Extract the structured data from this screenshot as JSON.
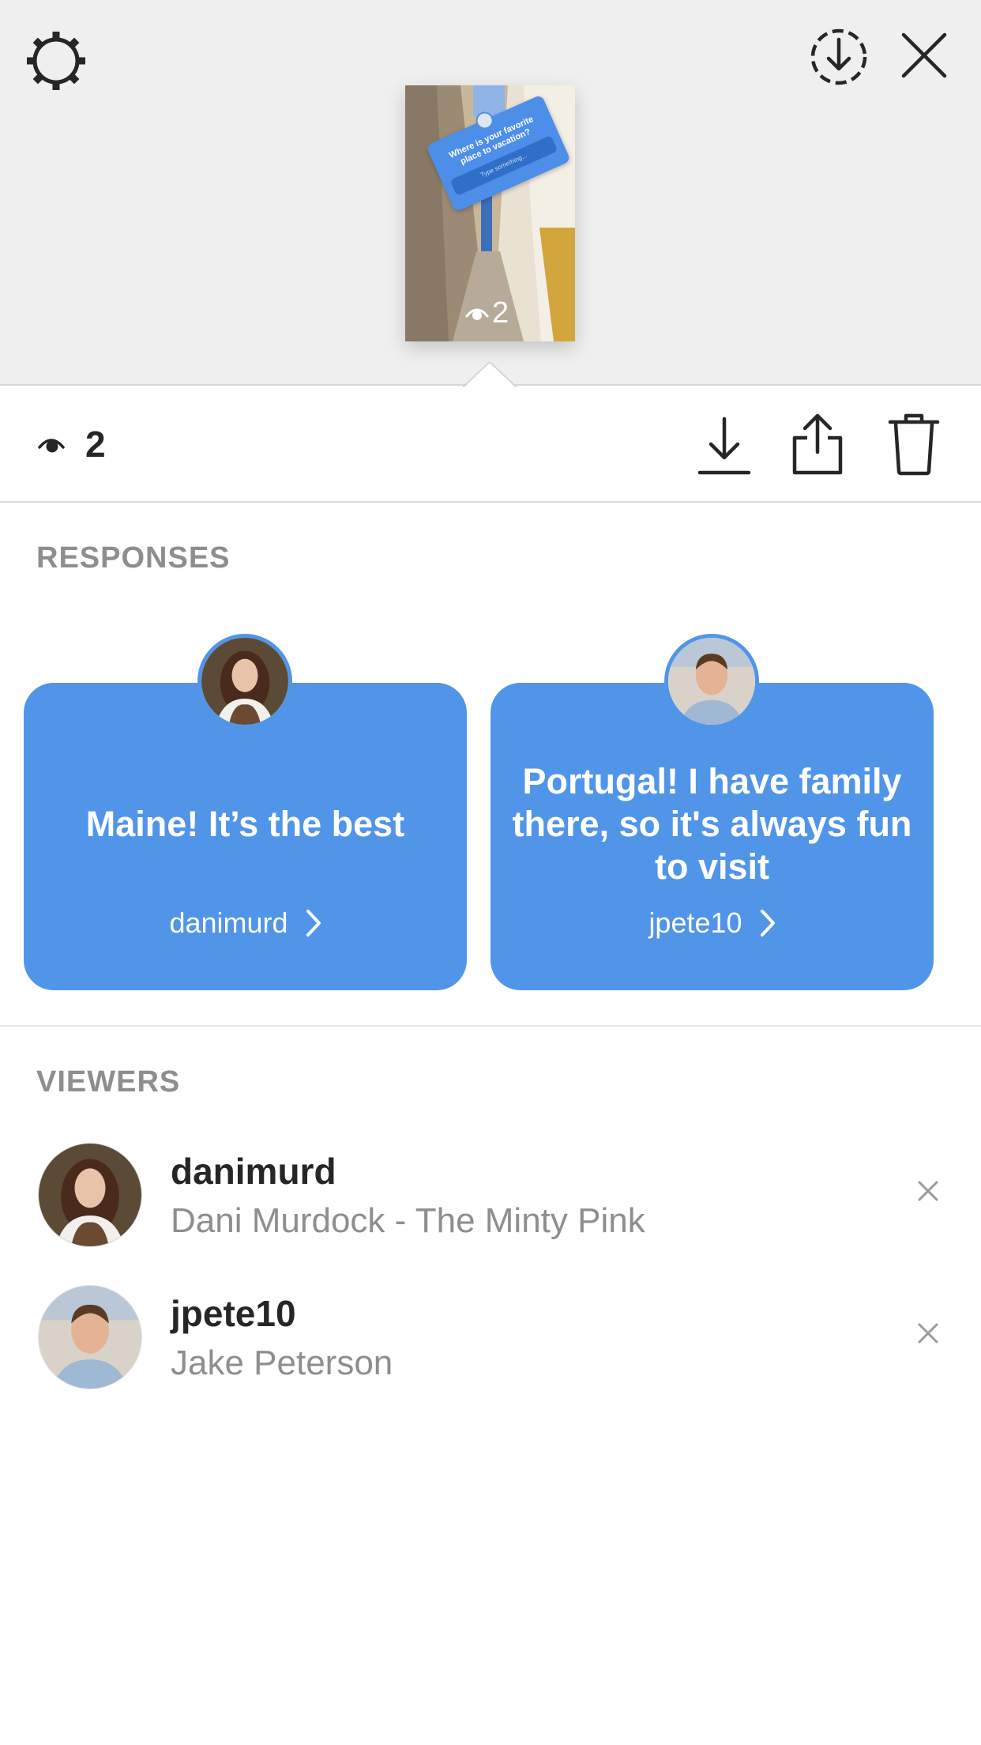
{
  "header": {
    "settings_icon": "gear-icon",
    "download_icon": "download-circle-icon",
    "close_icon": "close-icon"
  },
  "story_preview": {
    "question": "Where is your favorite place to vacation?",
    "field_placeholder": "Type something...",
    "view_count": "2",
    "sticker_color": "#4d8ee8"
  },
  "toolbar": {
    "view_count": "2",
    "icons": [
      "eye-icon",
      "save-icon",
      "share-icon",
      "trash-icon"
    ]
  },
  "responses": {
    "title": "RESPONSES",
    "card_color": "#5095e8",
    "items": [
      {
        "text": "Maine! It’s the best",
        "username": "danimurd"
      },
      {
        "text": "Portugal! I have family there, so it's always fun to visit",
        "username": "jpete10"
      }
    ]
  },
  "viewers": {
    "title": "VIEWERS",
    "items": [
      {
        "username": "danimurd",
        "full_name": "Dani Murdock - The Minty Pink"
      },
      {
        "username": "jpete10",
        "full_name": "Jake Peterson"
      }
    ]
  },
  "colors": {
    "top_background": "#efefef",
    "secondary_text": "#8e8e8e",
    "primary_text": "#262626"
  }
}
